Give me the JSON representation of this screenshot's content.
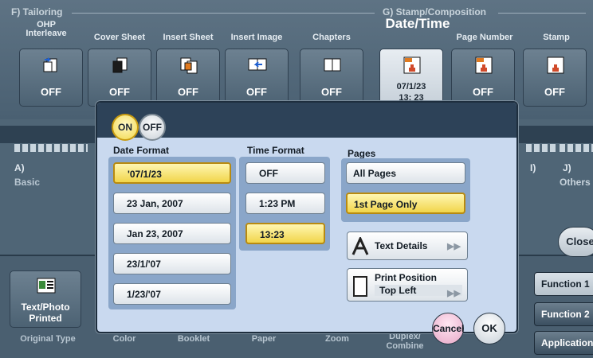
{
  "sections": {
    "tailoring": "F)  Tailoring",
    "stamp": "G)  Stamp/Composition"
  },
  "functions": [
    {
      "label": "OHP Interleave",
      "value": "OFF",
      "icon": "ohp-interleave-icon"
    },
    {
      "label": "Cover Sheet",
      "value": "OFF",
      "icon": "cover-sheet-icon"
    },
    {
      "label": "Insert Sheet",
      "value": "OFF",
      "icon": "insert-sheet-icon"
    },
    {
      "label": "Insert Image",
      "value": "OFF",
      "icon": "insert-image-icon"
    },
    {
      "label": "Chapters",
      "value": "OFF",
      "icon": "chapters-icon"
    },
    {
      "label": "Date/Time",
      "value": "07/1/23\n13: 23",
      "icon": "date-time-stamp-icon"
    },
    {
      "label": "Page Number",
      "value": "OFF",
      "icon": "page-number-icon"
    },
    {
      "label": "Stamp",
      "value": "OFF",
      "icon": "stamp-icon"
    }
  ],
  "background": {
    "left_section": "A)",
    "left_sub": "Basic",
    "right_i": "I)",
    "right_j": "J)",
    "right_sub": "Others",
    "text_photo": "Text/Photo Printed",
    "bottom_tabs": [
      "Original Type",
      "Color",
      "Booklet",
      "Paper",
      "Zoom",
      "Duplex/ Combine"
    ],
    "close": "Close",
    "side_tabs": [
      "Function 1",
      "Function 2",
      "Application"
    ]
  },
  "dialog": {
    "on": "ON",
    "off": "OFF",
    "date_format": {
      "title": "Date Format",
      "options": [
        "'07/1/23",
        "23 Jan, 2007",
        "Jan 23, 2007",
        "23/1/'07",
        "1/23/'07"
      ],
      "selected": 0
    },
    "time_format": {
      "title": "Time Format",
      "options": [
        "OFF",
        "1:23 PM",
        "13:23"
      ],
      "selected": 2
    },
    "pages": {
      "title": "Pages",
      "options": [
        "All Pages",
        "1st Page Only"
      ],
      "selected": 1
    },
    "text_details": "Text Details",
    "print_position_label": "Print Position",
    "print_position_value": "Top Left",
    "cancel": "Cancel",
    "ok": "OK"
  },
  "colors": {
    "selected_fill": "#f1d54b",
    "dialog_bg": "#c9d9ef",
    "group_bg": "#8aa6c9"
  }
}
